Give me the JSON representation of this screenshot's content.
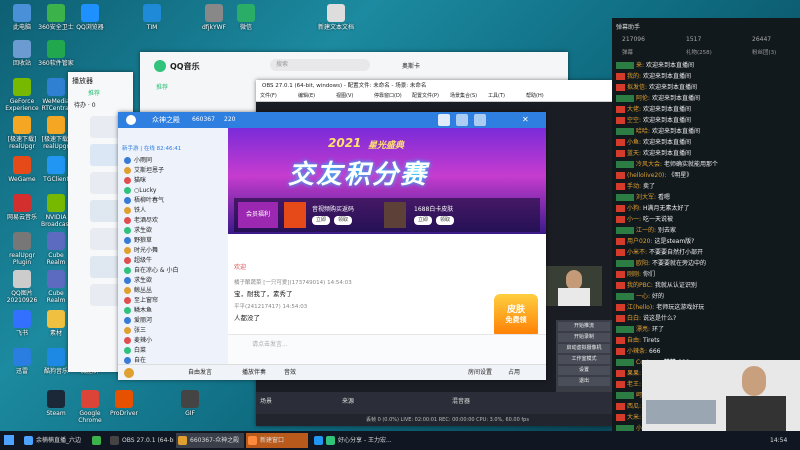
{
  "desktop_icons": [
    {
      "label": "此电脑",
      "color": "#4a90d9"
    },
    {
      "label": "360安全卫士",
      "color": "#3bb34a"
    },
    {
      "label": "QQ浏览器",
      "color": "#1e90ff"
    },
    {
      "label": "TIM",
      "color": "#1f8ad8"
    },
    {
      "label": "dfjkYWF",
      "color": "#888888"
    },
    {
      "label": "微信",
      "color": "#2aae67"
    },
    {
      "label": "新建文本文档",
      "color": "#dddddd"
    },
    {
      "label": "回收站",
      "color": "#6b9bd1"
    },
    {
      "label": "360软件管家",
      "color": "#21a84e"
    },
    {
      "label": "GeForce Experience",
      "color": "#76b900"
    },
    {
      "label": "WeMedia RTCentral",
      "color": "#2f7fd3"
    },
    {
      "label": "[极速下载] realUpgr",
      "color": "#f5a623"
    },
    {
      "label": "[极速下载] realUpgr",
      "color": "#f5a623"
    },
    {
      "label": "WeGame",
      "color": "#e64a19"
    },
    {
      "label": "TGClient",
      "color": "#2196f3"
    },
    {
      "label": "网易云音乐",
      "color": "#d32f2f"
    },
    {
      "label": "NVIDIA Broadcast",
      "color": "#76b900"
    },
    {
      "label": "realUpgr Plugin",
      "color": "#777777"
    },
    {
      "label": "Cube Realm",
      "color": "#5c6bc0"
    },
    {
      "label": "QQ图片 20210926",
      "color": "#cccccc"
    },
    {
      "label": "Cube Realm",
      "color": "#5c6bc0"
    },
    {
      "label": "飞书",
      "color": "#3370ff"
    },
    {
      "label": "素材",
      "color": "#f0c040"
    },
    {
      "label": "QQ音乐",
      "color": "#31c27c"
    },
    {
      "label": "迅雷",
      "color": "#2a7de1"
    },
    {
      "label": "酷狗音乐",
      "color": "#1e88e5"
    },
    {
      "label": "减脂群",
      "color": "#e0e0e0"
    },
    {
      "label": "Steam",
      "color": "#1b2838"
    },
    {
      "label": "Google Chrome",
      "color": "#db4437"
    },
    {
      "label": "ProDriver",
      "color": "#e65100"
    },
    {
      "label": "GIF",
      "color": "#444444"
    }
  ],
  "qqmusic": {
    "title": "QQ音乐",
    "search_placeholder": "搜索",
    "nav": "推荐",
    "user": "奥斯卡"
  },
  "small_window": {
    "title": "播放器",
    "nav1": "推荐",
    "nav2": "待办 · 0"
  },
  "obs": {
    "title": "OBS 27.0.1 (64-bit, windows) - 配置文件: 未命名 - 场景: 未命名",
    "menu": [
      "文件(F)",
      "编辑(E)",
      "视图(V)",
      "停靠窗口(D)",
      "配置文件(P)",
      "场景集合(S)",
      "工具(T)",
      "帮助(H)"
    ],
    "status": "丢帧 0 (0.0%)   LIVE: 02:00:01   REC: 00:00:00   CPU: 3.0%, 60.00 fps",
    "controls": [
      "开始推流",
      "开始录制",
      "启动虚拟摄像机",
      "工作室模式",
      "设置",
      "退出"
    ],
    "mixer_label": "混音器",
    "scene_label": "场景",
    "source_label": "来源"
  },
  "group_app": {
    "title": "众神之殿",
    "id": "660367",
    "member_count": "220",
    "banner_year": "2021",
    "banner_small": "星光盛典",
    "banner_main": "交友积分赛",
    "vip_label": "会员福利",
    "card1": "音视频购买返码",
    "card2": "1688白卡皮肤",
    "card_btn1": "立即",
    "card_btn2": "领取",
    "section": "新手游 | 在线 82:46:41",
    "members": [
      "小雨同",
      "艾斯坦恩子",
      "猫咪",
      "○Lucky",
      "梧柳叶春气",
      "铁人",
      "老酒尽欢",
      "求生欲",
      "野狼草",
      "时光小舞",
      "超级牛",
      "自在凉心 & 小白",
      "求生欲",
      "鲸丛丛",
      "至上窗帘",
      "鳞木鱼",
      "爱丽河",
      "张三",
      "麦辣小",
      "白菜",
      "自在",
      "无昵称"
    ],
    "msg_system": "欢迎",
    "msg1_user": "橘子酿蔬菜 [一只可爱](173749014)  14:54:03",
    "msg1_text": "宝，耐我了，素秀了",
    "msg2_user": "平平(241217417)  14:54:03",
    "msg2_text": "人都没了",
    "input_placeholder": "请点击发言...",
    "bottom_items": [
      "自由发言",
      "播放伴奏",
      "音效"
    ],
    "bottom_right": [
      "房间设置",
      "占用"
    ],
    "promo_line1": "皮肤",
    "promo_line2": "免费领"
  },
  "chat_panel": {
    "title": "弹幕助手",
    "stats": [
      "217096",
      "1517",
      "26447"
    ],
    "tabs": [
      "弹幕",
      "礼物(258)",
      "粉丝团(3)"
    ],
    "lines": [
      {
        "user": "来",
        "text": "欢迎来到本直播间"
      },
      {
        "user": "我的",
        "text": "欢迎来到本直播间"
      },
      {
        "user": "拟发信",
        "text": "欢迎来到本直播间"
      },
      {
        "user": "阿伦",
        "text": "欢迎来到本直播间"
      },
      {
        "user": "大佬",
        "text": "欢迎来到本直播间"
      },
      {
        "user": "空空",
        "text": "欢迎来到本直播间"
      },
      {
        "user": "哈哈",
        "text": "欢迎来到本直播间"
      },
      {
        "user": "小鱼",
        "text": "欢迎来到本直播间"
      },
      {
        "user": "蓝天",
        "text": "欢迎来到本直播间"
      },
      {
        "user": "冷风大会",
        "text": "老师确实就能用那个"
      },
      {
        "user": "(hellolive20)",
        "text": "《明星》"
      },
      {
        "user": "手动",
        "text": "卖了"
      },
      {
        "user": "刘大军",
        "text": "看嗯"
      },
      {
        "user": "小狗",
        "text": "H满月无素太好了"
      },
      {
        "user": "小一",
        "text": "吃一天说被"
      },
      {
        "user": "江一的",
        "text": "别去家"
      },
      {
        "user": "用户020",
        "text": "这是steam版?"
      },
      {
        "user": "小米不",
        "text": "不要要自然打小部开"
      },
      {
        "user": "欧阳",
        "text": "不要要就在旁边中的"
      },
      {
        "user": "刚刚",
        "text": "你们"
      },
      {
        "user": "我的PBC",
        "text": "我就从认证识别"
      },
      {
        "user": "一心",
        "text": "好的"
      },
      {
        "user": "江(hello)",
        "text": "老师玩这游戏好玩"
      },
      {
        "user": "白白",
        "text": "说这是什么?"
      },
      {
        "user": "漂亮",
        "text": "环了"
      },
      {
        "user": "自由",
        "text": "Tirets"
      },
      {
        "user": "小辣条",
        "text": "666"
      },
      {
        "user": "Cosiano",
        "text": "赞赞 666"
      },
      {
        "user": "果果",
        "text": "666"
      },
      {
        "user": "老王",
        "text": "哈哈哈"
      },
      {
        "user": "呵呵",
        "text": "来了"
      },
      {
        "user": "西瓜",
        "text": "好玩"
      },
      {
        "user": "大米",
        "text": "哈"
      },
      {
        "user": "小刘",
        "text": "666"
      }
    ]
  },
  "taskbar": {
    "items": [
      {
        "label": "余楠楠直播_六边",
        "color": "#4da3ff"
      },
      {
        "label": "",
        "color": "#3bb34a"
      },
      {
        "label": "OBS 27.0.1 (64-bit)",
        "color": "#444"
      },
      {
        "label": "660367-众神之殿",
        "color": "#e0a030"
      },
      {
        "label": "新建窗口",
        "color": "#ff8a3d"
      },
      {
        "label": "",
        "color": "#2196f3"
      },
      {
        "label": "好心分享 - 王力宏...",
        "color": "#31c27c"
      }
    ],
    "time": "14:54"
  }
}
